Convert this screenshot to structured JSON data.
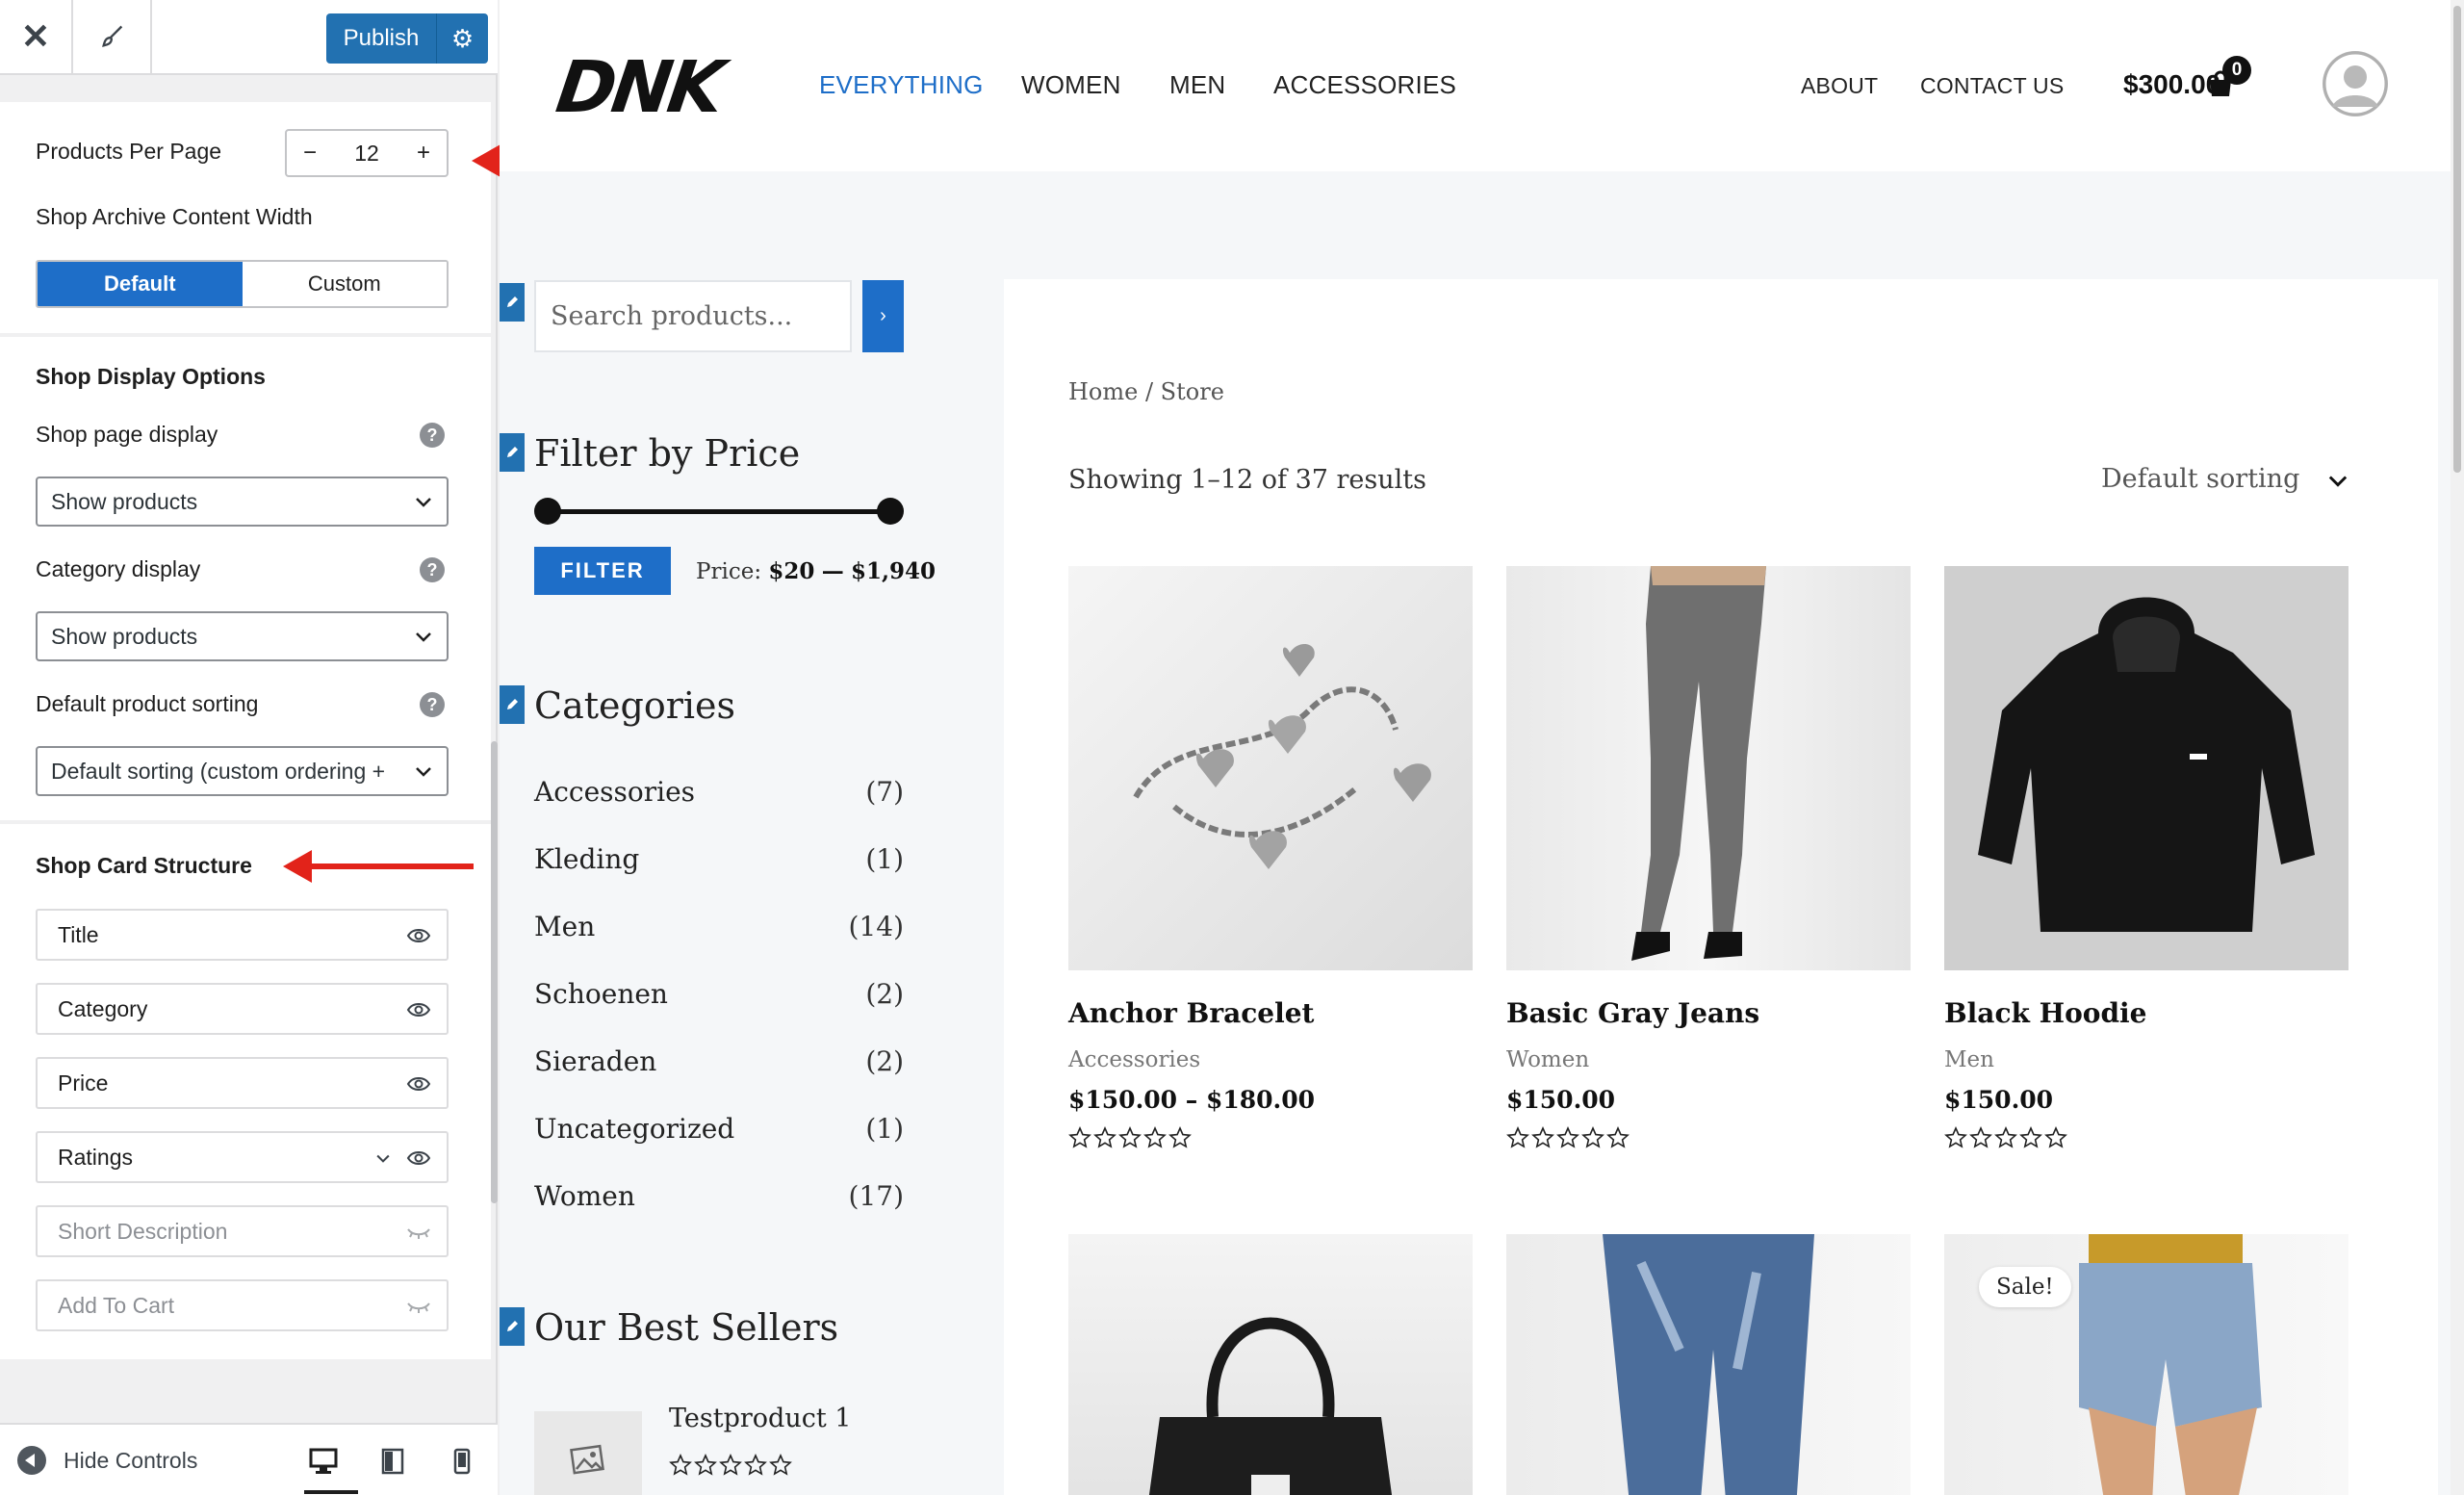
{
  "customizer": {
    "publish_label": "Publish",
    "products_per_page": {
      "label": "Products Per Page",
      "value": "12",
      "minus": "−",
      "plus": "+"
    },
    "archive_width": {
      "label": "Shop Archive Content Width",
      "options": [
        "Default",
        "Custom"
      ],
      "selected": "Default"
    },
    "display_options": {
      "heading": "Shop Display Options",
      "shop_page_display": {
        "label": "Shop page display",
        "value": "Show products"
      },
      "category_display": {
        "label": "Category display",
        "value": "Show products"
      },
      "default_sorting": {
        "label": "Default product sorting",
        "value": "Default sorting (custom ordering +"
      },
      "help_glyph": "?"
    },
    "card_structure": {
      "heading": "Shop Card Structure",
      "items": [
        {
          "label": "Title",
          "visible": true
        },
        {
          "label": "Category",
          "visible": true
        },
        {
          "label": "Price",
          "visible": true
        },
        {
          "label": "Ratings",
          "visible": true,
          "expandable": true
        },
        {
          "label": "Short Description",
          "visible": false
        },
        {
          "label": "Add To Cart",
          "visible": false
        }
      ]
    },
    "footer": {
      "hide_controls": "Hide Controls"
    },
    "accent_color": "#2271b1",
    "annotation_color": "#e2231a"
  },
  "site": {
    "logo": "DNK",
    "nav": [
      "EVERYTHING",
      "WOMEN",
      "MEN",
      "ACCESSORIES"
    ],
    "nav_right": [
      "ABOUT",
      "CONTACT US"
    ],
    "cart_total": "$300.00",
    "cart_count": "0",
    "search_placeholder": "Search products...",
    "search_button": "›",
    "filter": {
      "title": "Filter by Price",
      "button": "FILTER",
      "price_prefix": "Price:",
      "min": "$20",
      "separator": "—",
      "max": "$1,940"
    },
    "categories": {
      "title": "Categories",
      "items": [
        {
          "name": "Accessories",
          "count": "(7)"
        },
        {
          "name": "Kleding",
          "count": "(1)"
        },
        {
          "name": "Men",
          "count": "(14)"
        },
        {
          "name": "Schoenen",
          "count": "(2)"
        },
        {
          "name": "Sieraden",
          "count": "(2)"
        },
        {
          "name": "Uncategorized",
          "count": "(1)"
        },
        {
          "name": "Women",
          "count": "(17)"
        }
      ]
    },
    "best_sellers": {
      "title": "Our Best Sellers",
      "items": [
        {
          "name": "Testproduct 1",
          "rating": 0
        }
      ]
    },
    "breadcrumb": "Home / Store",
    "result_count": "Showing 1–12 of 37 results",
    "sorting": "Default sorting",
    "products": [
      {
        "name": "Anchor Bracelet",
        "category": "Accessories",
        "price": "$150.00 – $180.00",
        "rating": 0
      },
      {
        "name": "Basic Gray Jeans",
        "category": "Women",
        "price": "$150.00",
        "rating": 0
      },
      {
        "name": "Black Hoodie",
        "category": "Men",
        "price": "$150.00",
        "rating": 0
      }
    ],
    "sale_badge": "Sale!",
    "accent_color": "#1e6ec8"
  }
}
